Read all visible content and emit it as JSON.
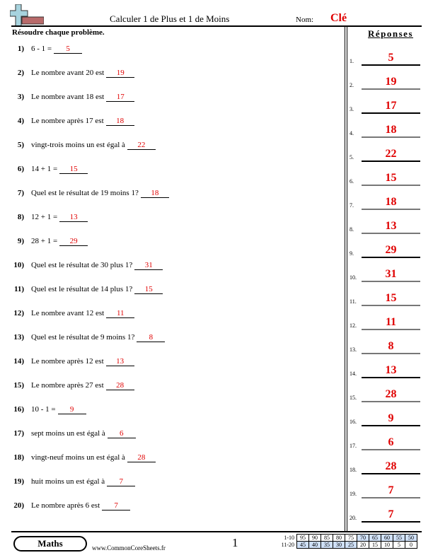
{
  "header": {
    "logo_icon": "plus-minus-icon",
    "title": "Calculer 1 de Plus et 1 de Moins",
    "name_label": "Nom:",
    "name_value": "Clé"
  },
  "instructions": "Résoudre chaque problème.",
  "answers_title": "Réponses",
  "problems": [
    {
      "num": "1)",
      "text": "6 - 1 =",
      "answer": "5"
    },
    {
      "num": "2)",
      "text": "Le nombre avant 20 est",
      "answer": "19"
    },
    {
      "num": "3)",
      "text": "Le nombre avant 18 est",
      "answer": "17"
    },
    {
      "num": "4)",
      "text": "Le nombre après 17 est",
      "answer": "18"
    },
    {
      "num": "5)",
      "text": "vingt-trois moins un est égal à",
      "answer": "22"
    },
    {
      "num": "6)",
      "text": "14 + 1 =",
      "answer": "15"
    },
    {
      "num": "7)",
      "text": "Quel est le résultat de 19 moins 1?",
      "answer": "18"
    },
    {
      "num": "8)",
      "text": "12 + 1 =",
      "answer": "13"
    },
    {
      "num": "9)",
      "text": "28 + 1 =",
      "answer": "29"
    },
    {
      "num": "10)",
      "text": "Quel est le résultat de 30 plus 1?",
      "answer": "31"
    },
    {
      "num": "11)",
      "text": "Quel est le résultat de 14 plus 1?",
      "answer": "15"
    },
    {
      "num": "12)",
      "text": "Le nombre avant 12 est",
      "answer": "11"
    },
    {
      "num": "13)",
      "text": "Quel est le résultat de 9 moins 1?",
      "answer": "8"
    },
    {
      "num": "14)",
      "text": "Le nombre après 12 est",
      "answer": "13"
    },
    {
      "num": "15)",
      "text": "Le nombre après 27 est",
      "answer": "28"
    },
    {
      "num": "16)",
      "text": "10 - 1 =",
      "answer": "9"
    },
    {
      "num": "17)",
      "text": "sept moins un est égal à",
      "answer": "6"
    },
    {
      "num": "18)",
      "text": "vingt-neuf moins un est égal à",
      "answer": "28"
    },
    {
      "num": "19)",
      "text": "huit moins un est égal à",
      "answer": "7"
    },
    {
      "num": "20)",
      "text": "Le nombre après 6 est",
      "answer": "7"
    }
  ],
  "answer_key": [
    {
      "n": "1.",
      "v": "5",
      "grey": false
    },
    {
      "n": "2.",
      "v": "19",
      "grey": true
    },
    {
      "n": "3.",
      "v": "17",
      "grey": false
    },
    {
      "n": "4.",
      "v": "18",
      "grey": true
    },
    {
      "n": "5.",
      "v": "22",
      "grey": false
    },
    {
      "n": "6.",
      "v": "15",
      "grey": true
    },
    {
      "n": "7.",
      "v": "18",
      "grey": true
    },
    {
      "n": "8.",
      "v": "13",
      "grey": true
    },
    {
      "n": "9.",
      "v": "29",
      "grey": false
    },
    {
      "n": "10.",
      "v": "31",
      "grey": true
    },
    {
      "n": "11.",
      "v": "15",
      "grey": true
    },
    {
      "n": "12.",
      "v": "11",
      "grey": true
    },
    {
      "n": "13.",
      "v": "8",
      "grey": true
    },
    {
      "n": "14.",
      "v": "13",
      "grey": false
    },
    {
      "n": "15.",
      "v": "28",
      "grey": true
    },
    {
      "n": "16.",
      "v": "9",
      "grey": false
    },
    {
      "n": "17.",
      "v": "6",
      "grey": true
    },
    {
      "n": "18.",
      "v": "28",
      "grey": false
    },
    {
      "n": "19.",
      "v": "7",
      "grey": true
    },
    {
      "n": "20.",
      "v": "7",
      "grey": false
    }
  ],
  "footer": {
    "subject": "Maths",
    "site": "www.CommonCoreSheets.fr",
    "page": "1"
  },
  "score_table": {
    "rows": [
      {
        "label": "1-10",
        "cells": [
          "95",
          "90",
          "85",
          "80",
          "75",
          "70",
          "65",
          "60",
          "55",
          "50"
        ],
        "highlight_from": 5,
        "highlight_to": 9
      },
      {
        "label": "11-20",
        "cells": [
          "45",
          "40",
          "35",
          "30",
          "25",
          "20",
          "15",
          "10",
          "5",
          "0"
        ],
        "highlight_from": 0,
        "highlight_to": 4
      }
    ]
  }
}
